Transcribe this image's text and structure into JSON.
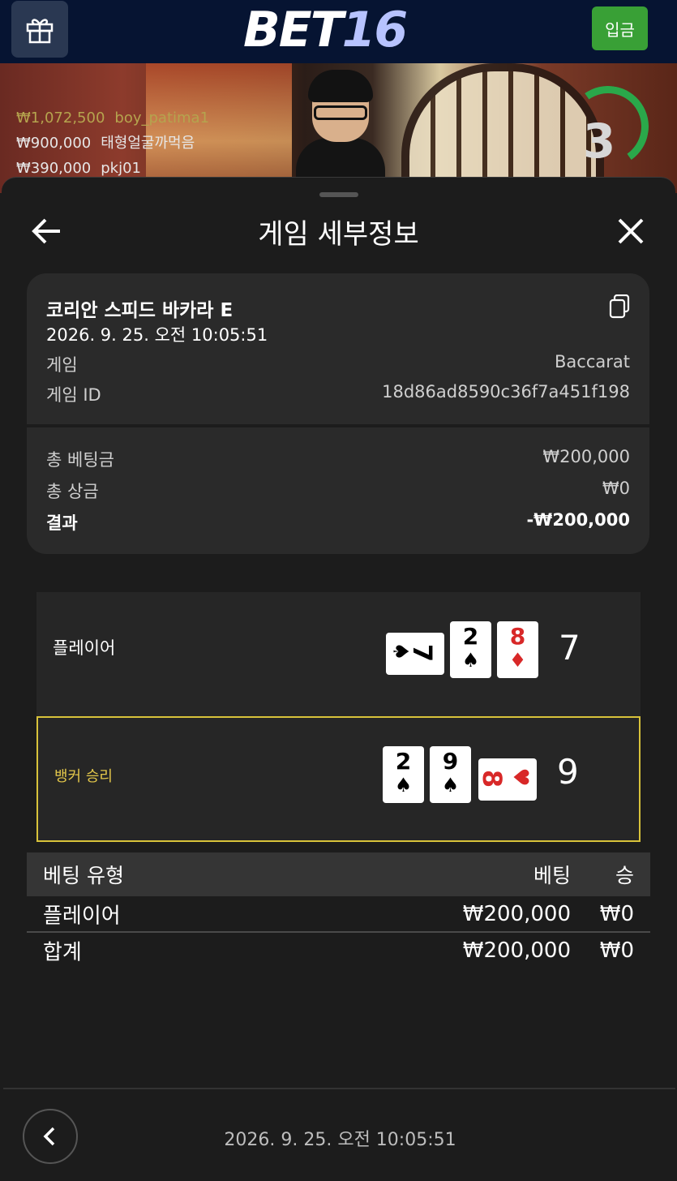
{
  "header": {
    "logo_part1": "BET",
    "logo_part2": "16",
    "deposit_label": "입금"
  },
  "video": {
    "winners": [
      {
        "amount": "₩1,072,500",
        "name": "boy_patima1"
      },
      {
        "amount": "₩900,000",
        "name": "태형얼굴까먹음"
      },
      {
        "amount": "₩390,000",
        "name": "pkj01"
      }
    ],
    "timer": "3"
  },
  "panel": {
    "title": "게임 세부정보",
    "summary": {
      "table_name": "코리안 스피드 바카라 E",
      "datetime": "2026. 9. 25. 오전 10:05:51",
      "game_label": "게임",
      "game_value": "Baccarat",
      "game_id_label": "게임 ID",
      "game_id_value": "18d86ad8590c36f7a451f198",
      "total_bet_label": "총 베팅금",
      "total_bet_value": "₩200,000",
      "total_win_label": "총 상금",
      "total_win_value": "₩0",
      "result_label": "결과",
      "result_value": "-₩200,000"
    },
    "player": {
      "label": "플레이어",
      "cards": [
        {
          "rank": "7",
          "suit": "♠",
          "color": "black",
          "rotated": true
        },
        {
          "rank": "2",
          "suit": "♠",
          "color": "black"
        },
        {
          "rank": "8",
          "suit": "♦",
          "color": "red"
        }
      ],
      "score": "7"
    },
    "banker": {
      "label": "뱅커 승리",
      "cards": [
        {
          "rank": "2",
          "suit": "♠",
          "color": "black"
        },
        {
          "rank": "9",
          "suit": "♠",
          "color": "black"
        },
        {
          "rank": "8",
          "suit": "♥",
          "color": "red",
          "rotated": true
        }
      ],
      "score": "9"
    },
    "bet_table": {
      "headers": {
        "type": "베팅 유형",
        "bet": "베팅",
        "win": "승"
      },
      "rows": [
        {
          "type": "플레이어",
          "bet": "₩200,000",
          "win": "₩0"
        },
        {
          "type": "합계",
          "bet": "₩200,000",
          "win": "₩0"
        }
      ]
    },
    "footer_datetime": "2026. 9. 25. 오전 10:05:51"
  },
  "colors": {
    "accent_gold": "#d8c23a",
    "deposit_green": "#39a036",
    "header_navy": "#061432"
  },
  "icons": [
    "gift-icon",
    "back-arrow-icon",
    "close-icon",
    "copy-icon",
    "chevron-left-icon"
  ]
}
